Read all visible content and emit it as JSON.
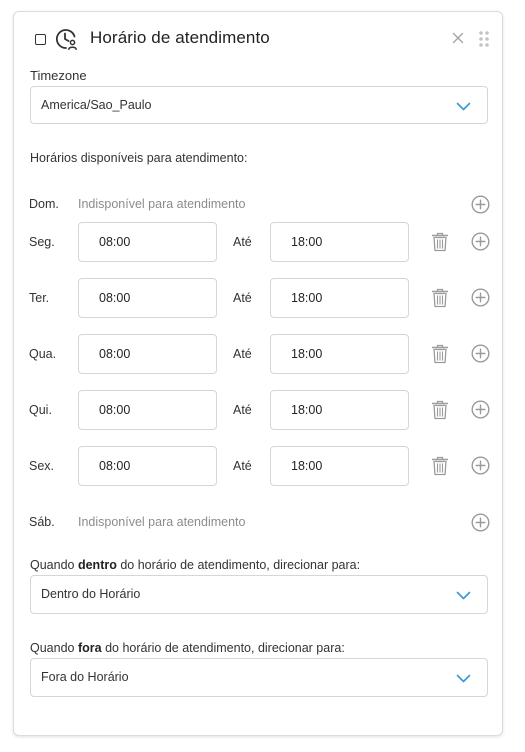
{
  "header": {
    "title": "Horário de atendimento"
  },
  "timezone": {
    "label": "Timezone",
    "value": "America/Sao_Paulo"
  },
  "schedule": {
    "heading": "Horários disponíveis para atendimento:",
    "until_label": "Até",
    "unavailable_text": "Indisponível para atendimento",
    "days": [
      {
        "day": "Dom.",
        "available": false
      },
      {
        "day": "Seg.",
        "available": true,
        "start": "08:00",
        "end": "18:00"
      },
      {
        "day": "Ter.",
        "available": true,
        "start": "08:00",
        "end": "18:00"
      },
      {
        "day": "Qua.",
        "available": true,
        "start": "08:00",
        "end": "18:00"
      },
      {
        "day": "Qui.",
        "available": true,
        "start": "08:00",
        "end": "18:00"
      },
      {
        "day": "Sex.",
        "available": true,
        "start": "08:00",
        "end": "18:00"
      },
      {
        "day": "Sáb.",
        "available": false
      }
    ]
  },
  "inside_hours": {
    "label_prefix": "Quando ",
    "label_bold": "dentro",
    "label_suffix": " do horário de atendimento, direcionar para:",
    "value": "Dentro do Horário"
  },
  "outside_hours": {
    "label_prefix": "Quando ",
    "label_bold": "fora",
    "label_suffix": " do horário de atendimento, direcionar para:",
    "value": "Fora do Horário"
  },
  "colors": {
    "chevron": "#3a9ad9",
    "icon_gray": "#9a9a9a"
  }
}
